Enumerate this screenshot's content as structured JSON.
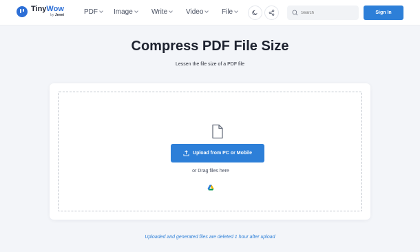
{
  "header": {
    "logo": {
      "name_part1": "Tiny",
      "name_part2": "Wow",
      "by": "by",
      "by_brand": "Jenni"
    },
    "nav": [
      "PDF",
      "Image",
      "Write",
      "Video",
      "File"
    ],
    "theme_icon": "moon-icon",
    "share_icon": "share-icon",
    "search": {
      "placeholder": "Search",
      "icon": "search-icon"
    },
    "signin_label": "Sign In"
  },
  "main": {
    "title": "Compress PDF File Size",
    "subtitle": "Lessen the file size of a PDF file",
    "dropzone": {
      "file_icon": "document-icon",
      "upload_label": "Upload from PC or Mobile",
      "upload_icon": "upload-icon",
      "drag_text": "or Drag files here",
      "drive_icon": "google-drive-icon"
    },
    "footer_note": "Uploaded and generated files are deleted 1 hour after upload"
  },
  "colors": {
    "accent": "#2d7fd8",
    "background": "#f3f5f9",
    "text": "#1e2330"
  }
}
